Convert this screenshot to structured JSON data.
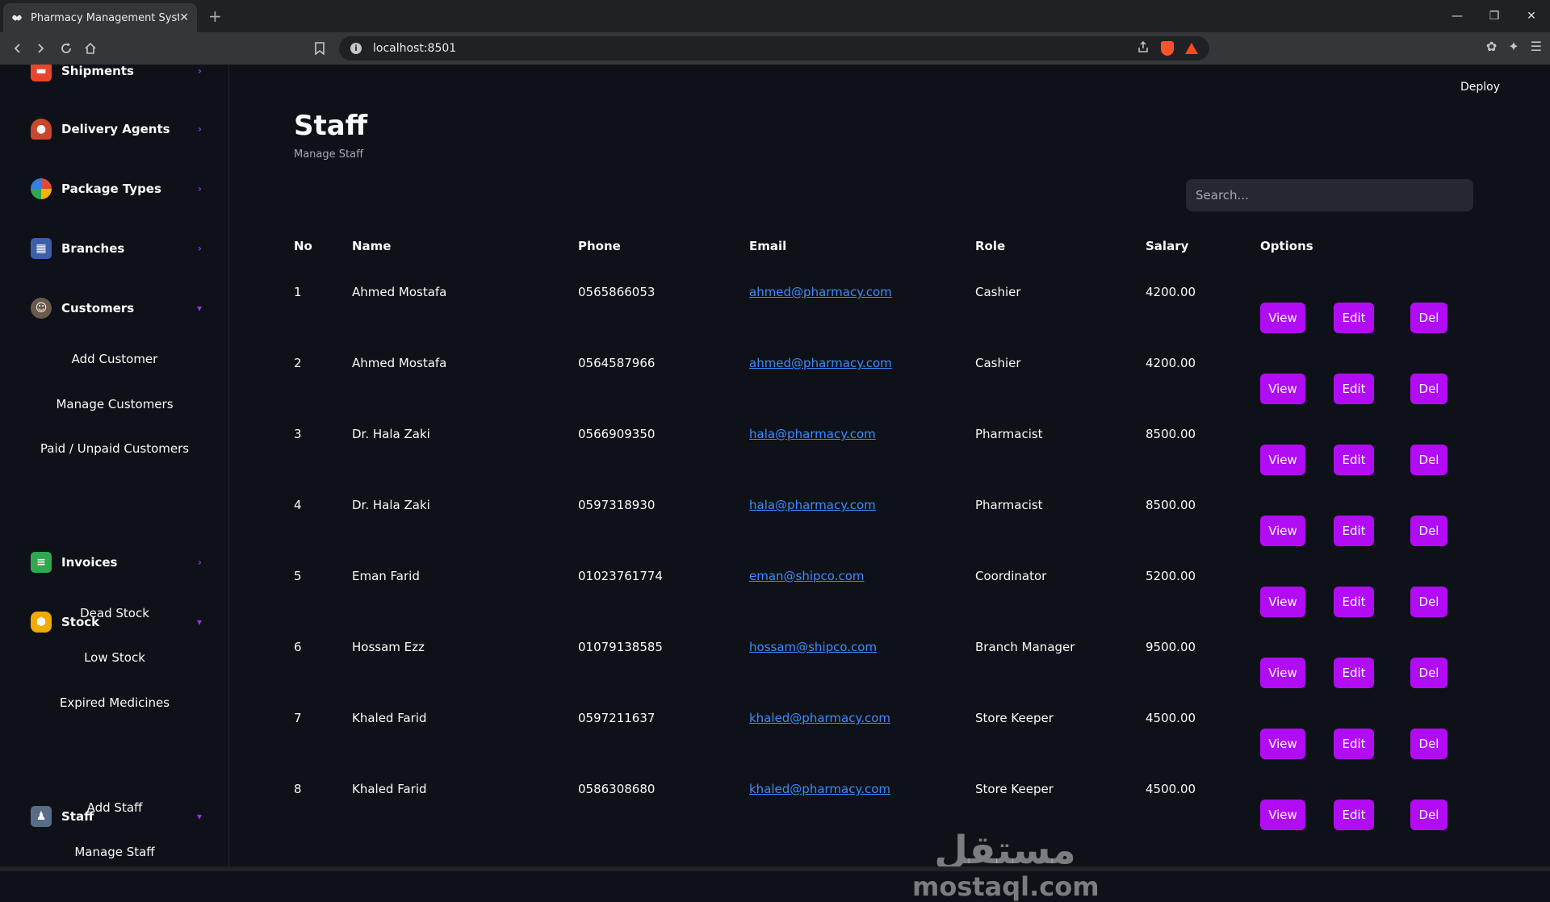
{
  "browser": {
    "tab_title": "Pharmacy Management System",
    "tab_close": "✕",
    "new_tab": "+",
    "url": "localhost:8501",
    "win_min": "—",
    "win_max": "❐",
    "win_close": "✕"
  },
  "sidebar": {
    "items": [
      {
        "label": "Shipments",
        "icon": "truck-icon",
        "chev": "›"
      },
      {
        "label": "Delivery Agents",
        "icon": "agent-icon",
        "chev": "›"
      },
      {
        "label": "Package Types",
        "icon": "package-icon",
        "chev": "›"
      },
      {
        "label": "Branches",
        "icon": "branch-icon",
        "chev": "›"
      },
      {
        "label": "Customers",
        "icon": "customer-icon",
        "chev": "▾"
      },
      {
        "label": "Invoices",
        "icon": "invoice-icon",
        "chev": "›"
      },
      {
        "label": "Stock",
        "icon": "stock-icon",
        "chev": "▾"
      },
      {
        "label": "Staff",
        "icon": "staff-icon",
        "chev": "▾"
      }
    ],
    "customer_sub": [
      "Add Customer",
      "Manage Customers",
      "Paid / Unpaid Customers"
    ],
    "stock_sub": [
      "Dead Stock",
      "Low Stock",
      "Expired Medicines"
    ],
    "staff_sub": [
      "Add Staff",
      "Manage Staff"
    ]
  },
  "header": {
    "deploy": "Deploy",
    "title": "Staff",
    "subtitle": "Manage Staff",
    "search_placeholder": "Search..."
  },
  "table": {
    "columns": [
      "No",
      "Name",
      "Phone",
      "Email",
      "Role",
      "Salary",
      "Options"
    ],
    "rows": [
      {
        "no": "1",
        "name": "Ahmed Mostafa",
        "phone": "0565866053",
        "email": "ahmed@pharmacy.com",
        "role": "Cashier",
        "salary": "4200.00"
      },
      {
        "no": "2",
        "name": "Ahmed Mostafa",
        "phone": "0564587966",
        "email": "ahmed@pharmacy.com",
        "role": "Cashier",
        "salary": "4200.00"
      },
      {
        "no": "3",
        "name": "Dr. Hala Zaki",
        "phone": "0566909350",
        "email": "hala@pharmacy.com",
        "role": "Pharmacist",
        "salary": "8500.00"
      },
      {
        "no": "4",
        "name": "Dr. Hala Zaki",
        "phone": "0597318930",
        "email": "hala@pharmacy.com",
        "role": "Pharmacist",
        "salary": "8500.00"
      },
      {
        "no": "5",
        "name": "Eman Farid",
        "phone": "01023761774",
        "email": "eman@shipco.com",
        "role": "Coordinator",
        "salary": "5200.00"
      },
      {
        "no": "6",
        "name": "Hossam Ezz",
        "phone": "01079138585",
        "email": "hossam@shipco.com",
        "role": "Branch Manager",
        "salary": "9500.00"
      },
      {
        "no": "7",
        "name": "Khaled Farid",
        "phone": "0597211637",
        "email": "khaled@pharmacy.com",
        "role": "Store Keeper",
        "salary": "4500.00"
      },
      {
        "no": "8",
        "name": "Khaled Farid",
        "phone": "0586308680",
        "email": "khaled@pharmacy.com",
        "role": "Store Keeper",
        "salary": "4500.00"
      }
    ],
    "buttons": {
      "view": "View",
      "edit": "Edit",
      "del": "Del"
    }
  },
  "watermark": {
    "arabic": "مستقل",
    "latin": "mostaql.com"
  },
  "colors": {
    "accent": "#b10cf4",
    "link": "#3d8bfd",
    "background": "#0e1117"
  }
}
